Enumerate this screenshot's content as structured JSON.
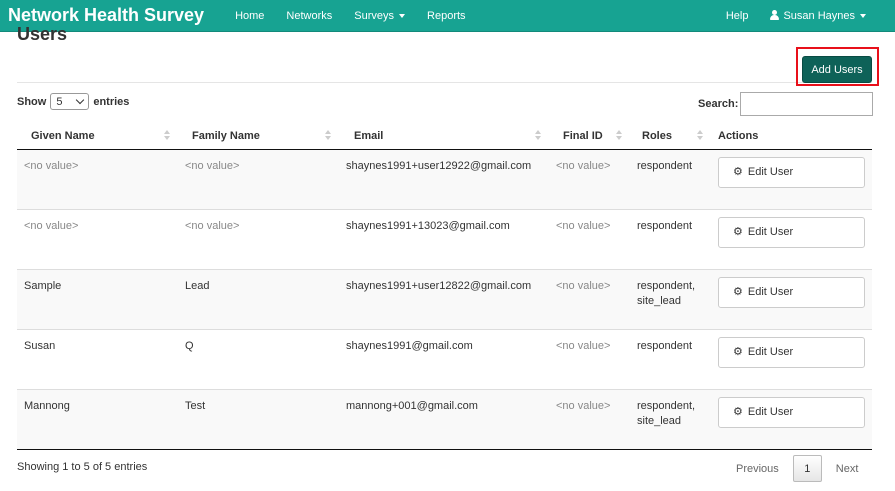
{
  "nav": {
    "brand": "Network Health Survey",
    "links": [
      "Home",
      "Networks",
      "Surveys",
      "Reports"
    ],
    "help": "Help",
    "user": "Susan Haynes"
  },
  "page": {
    "title": "Users",
    "add_button": "Add Users"
  },
  "controls": {
    "show_label": "Show",
    "entries_value": "5",
    "entries_label": "entries",
    "search_label": "Search:",
    "search_value": ""
  },
  "table": {
    "headers": [
      "Given Name",
      "Family Name",
      "Email",
      "Final ID",
      "Roles",
      "Actions"
    ],
    "rows": [
      {
        "given": "<no value>",
        "family": "<no value>",
        "email": "shaynes1991+user12922@gmail.com",
        "final_id": "<no value>",
        "roles_line1": "respondent",
        "roles_line2": "",
        "action": "Edit User"
      },
      {
        "given": "<no value>",
        "family": "<no value>",
        "email": "shaynes1991+13023@gmail.com",
        "final_id": "<no value>",
        "roles_line1": "respondent",
        "roles_line2": "",
        "action": "Edit User"
      },
      {
        "given": "Sample",
        "family": "Lead",
        "email": "shaynes1991+user12822@gmail.com",
        "final_id": "<no value>",
        "roles_line1": "respondent,",
        "roles_line2": "site_lead",
        "action": "Edit User"
      },
      {
        "given": "Susan",
        "family": "Q",
        "email": "shaynes1991@gmail.com",
        "final_id": "<no value>",
        "roles_line1": "respondent",
        "roles_line2": "",
        "action": "Edit User"
      },
      {
        "given": "Mannong",
        "family": "Test",
        "email": "mannong+001@gmail.com",
        "final_id": "<no value>",
        "roles_line1": "respondent,",
        "roles_line2": "site_lead",
        "action": "Edit User"
      }
    ]
  },
  "footer": {
    "info": "Showing 1 to 5 of 5 entries",
    "previous": "Previous",
    "page": "1",
    "next": "Next"
  },
  "colors": {
    "navbar": "#17a392",
    "primary_button": "#0e6258",
    "highlight": "#e8101a"
  }
}
